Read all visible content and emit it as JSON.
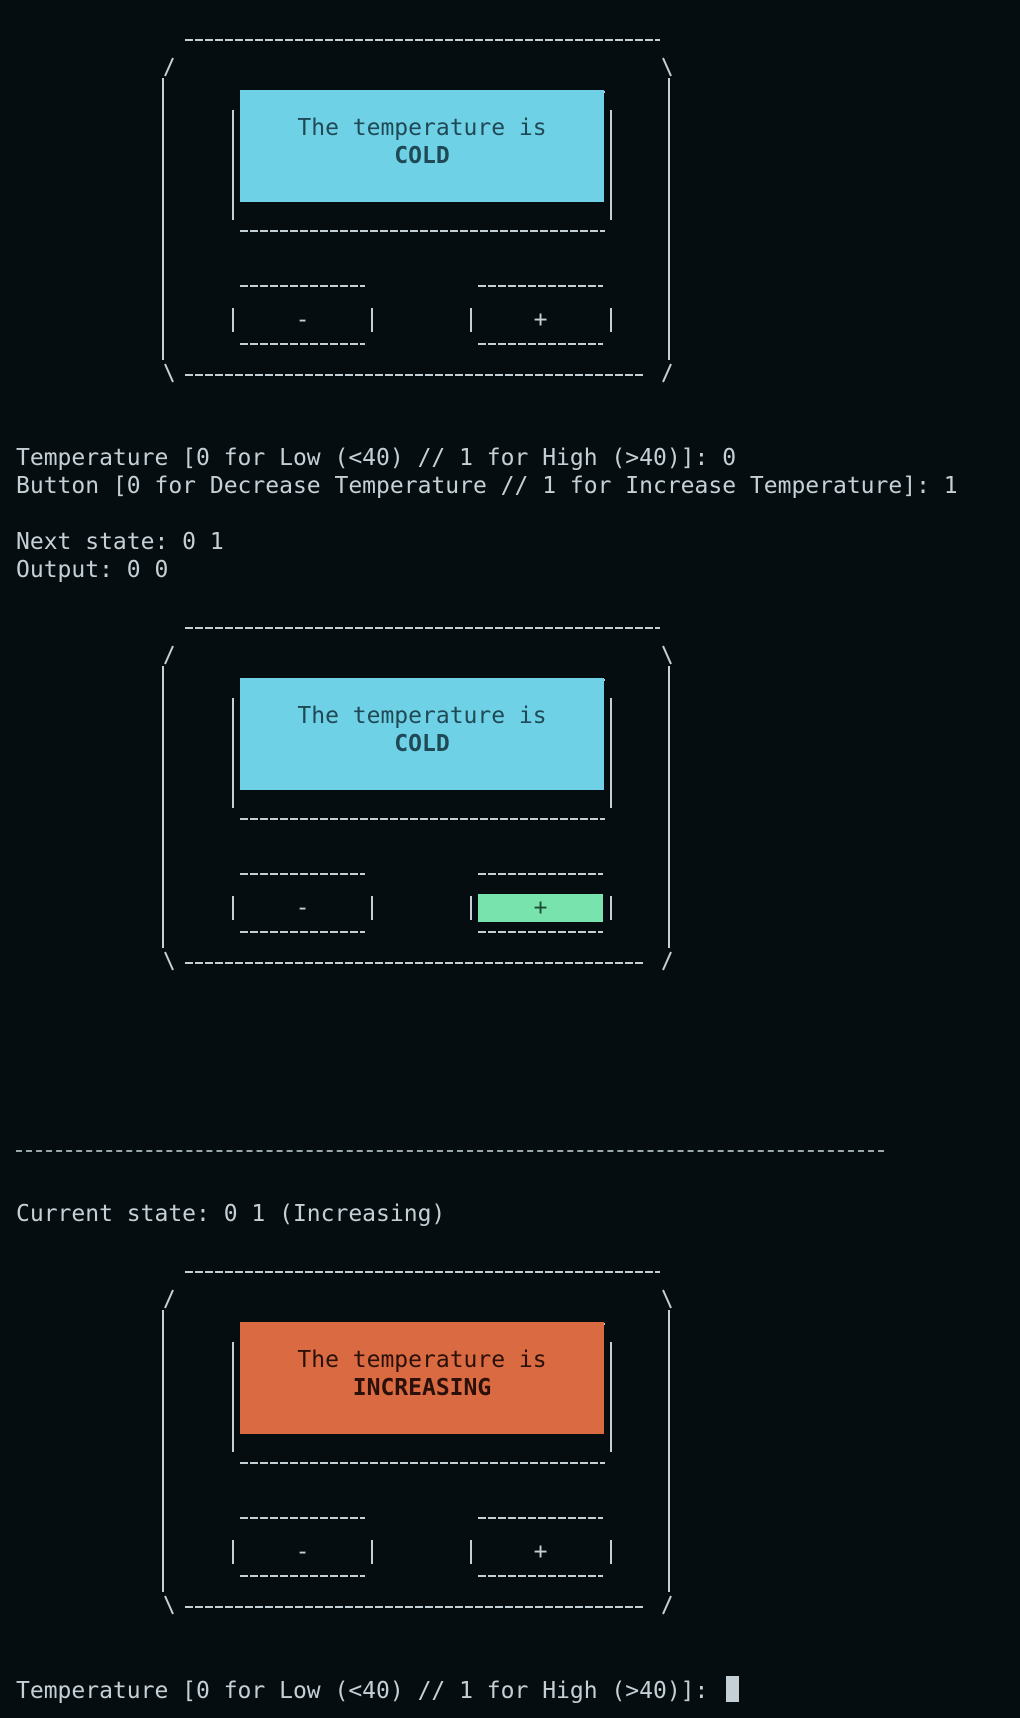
{
  "prompts": {
    "temp_prompt_1": "Temperature [0 for Low (<40) // 1 for High (>40)]: 0",
    "button_prompt_1": "Button [0 for Decrease Temperature // 1 for Increase Temperature]: 1",
    "next_state": "Next state: 0 1",
    "output": "Output: 0 0",
    "current_state": "Current state: 0 1 (Increasing)",
    "temp_prompt_2": "Temperature [0 for Low (<40) // 1 for High (>40)]: "
  },
  "devices": [
    {
      "display_line1": "The temperature is",
      "display_line2": "COLD",
      "display_color": "#6fd1e6",
      "minus_label": "-",
      "plus_label": "+"
    },
    {
      "display_line1": "The temperature is",
      "display_line2": "COLD",
      "display_color": "#6fd1e6",
      "minus_label": "-",
      "plus_label": "+",
      "plus_highlight_color": "#78e3ac"
    },
    {
      "display_line1": "The temperature is",
      "display_line2": "INCREASING",
      "display_color": "#d96a42",
      "minus_label": "-",
      "plus_label": "+"
    }
  ],
  "colors": {
    "background": "#060d10",
    "text": "#c4d0d6",
    "cold": "#6fd1e6",
    "increasing": "#d96a42",
    "pressed": "#78e3ac"
  },
  "icons": {
    "cursor": "block-cursor-icon"
  }
}
